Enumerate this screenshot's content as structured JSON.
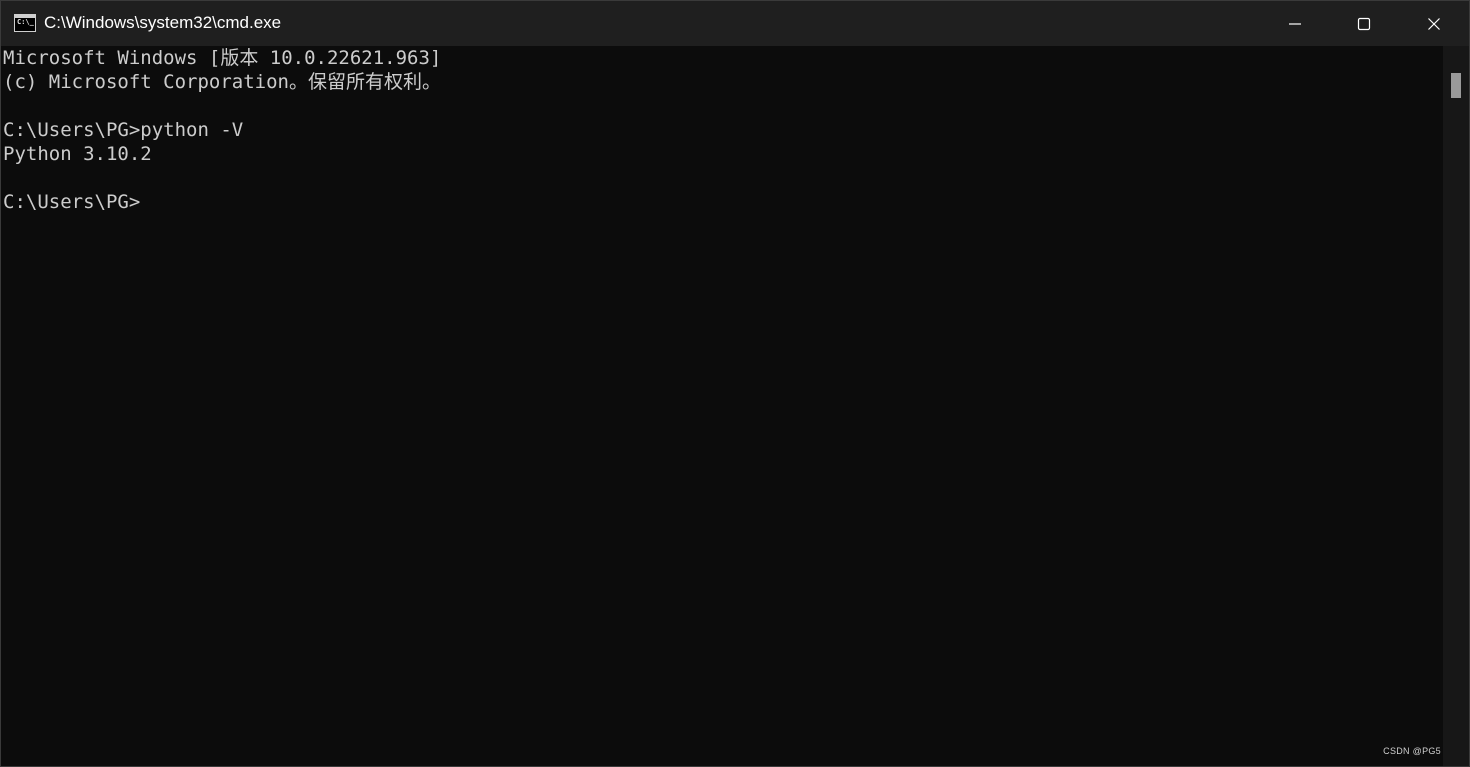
{
  "window": {
    "title": "C:\\Windows\\system32\\cmd.exe",
    "app_icon": "cmd-icon",
    "app_icon_text": "C:\\_",
    "controls": {
      "minimize": "minimize-icon",
      "maximize": "maximize-icon",
      "close": "close-icon"
    }
  },
  "terminal": {
    "lines": [
      "Microsoft Windows [版本 10.0.22621.963]",
      "(c) Microsoft Corporation。保留所有权利。",
      "",
      "C:\\Users\\PG>python -V",
      "Python 3.10.2",
      "",
      "C:\\Users\\PG>"
    ]
  },
  "watermark": "CSDN @PG5",
  "colors": {
    "terminal_bg": "#0c0c0c",
    "terminal_fg": "#cccccc",
    "titlebar_bg": "#1f1f1f",
    "titlebar_fg": "#ffffff"
  }
}
